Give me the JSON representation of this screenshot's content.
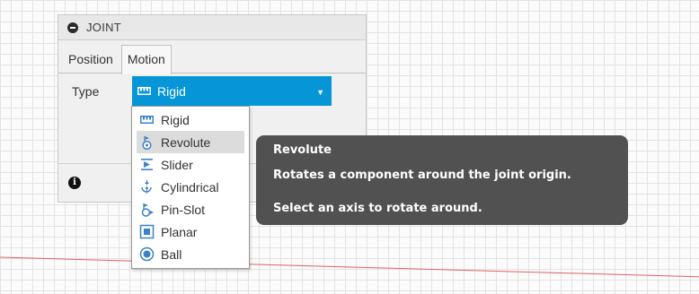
{
  "panel": {
    "title": "JOINT",
    "tabs": [
      {
        "label": "Position"
      },
      {
        "label": "Motion"
      }
    ],
    "type_label": "Type",
    "selected_type": "Rigid",
    "info_icon_glyph": "i"
  },
  "menu": {
    "items": [
      {
        "label": "Rigid",
        "icon": "rigid-icon"
      },
      {
        "label": "Revolute",
        "icon": "revolute-icon"
      },
      {
        "label": "Slider",
        "icon": "slider-icon"
      },
      {
        "label": "Cylindrical",
        "icon": "cylindrical-icon"
      },
      {
        "label": "Pin-Slot",
        "icon": "pin-slot-icon"
      },
      {
        "label": "Planar",
        "icon": "planar-icon"
      },
      {
        "label": "Ball",
        "icon": "ball-icon"
      }
    ]
  },
  "tooltip": {
    "title": "Revolute",
    "line1": "Rotates a component around the joint origin.",
    "line2": "Select an axis to rotate around."
  },
  "colors": {
    "accent": "#0696d7",
    "tooltip_bg": "#515151",
    "axis_red": "#e06060"
  }
}
